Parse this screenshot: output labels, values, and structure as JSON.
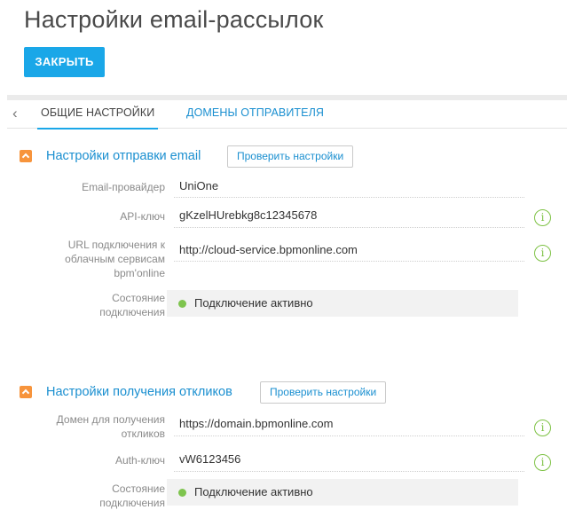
{
  "page": {
    "title": "Настройки email-рассылок",
    "close_label": "ЗАКРЫТЬ"
  },
  "tabs": [
    {
      "label": "ОБЩИЕ НАСТРОЙКИ",
      "active": true
    },
    {
      "label": "ДОМЕНЫ ОТПРАВИТЕЛЯ",
      "active": false
    }
  ],
  "send_section": {
    "title": "Настройки отправки email",
    "check_label": "Проверить настройки",
    "fields": [
      {
        "label": "Email-провайдер",
        "value": "UniOne"
      },
      {
        "label": "API-ключ",
        "value": "gKzelHUrebkg8c12345678"
      },
      {
        "label": "URL подключения к облачным сервисам bpm'online",
        "value": "http://cloud-service.bpmonline.com"
      }
    ],
    "status_label": "Состояние подключения",
    "status_text": "Подключение активно"
  },
  "receive_section": {
    "title": "Настройки получения откликов",
    "check_label": "Проверить настройки",
    "fields": [
      {
        "label": "Домен для получения откликов",
        "value": "https://domain.bpmonline.com"
      },
      {
        "label": "Auth-ключ",
        "value": "vW6123456"
      }
    ],
    "status_label": "Состояние подключения",
    "status_text": "Подключение активно"
  },
  "info_icon_glyph": "i",
  "back_glyph": "‹",
  "colors": {
    "accent": "#1aa7e8",
    "link": "#1a8fd0",
    "collapse": "#f7943c",
    "status_ok": "#7ec44e"
  }
}
